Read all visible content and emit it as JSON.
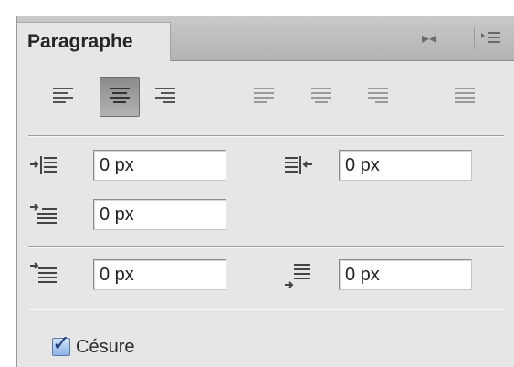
{
  "panel": {
    "tab_label": "Paragraphe",
    "tab_controls": {
      "collapse": "expand-arrows-icon",
      "menu": "panel-menu-icon"
    }
  },
  "alignment_buttons": [
    {
      "name": "align-left",
      "active": false
    },
    {
      "name": "align-center",
      "active": true
    },
    {
      "name": "align-right",
      "active": false
    },
    {
      "name": "justify-last-left",
      "active": false
    },
    {
      "name": "justify-last-center",
      "active": false
    },
    {
      "name": "justify-last-right",
      "active": false
    },
    {
      "name": "justify-all",
      "active": false
    }
  ],
  "indents": {
    "left_indent": "0 px",
    "right_indent": "0 px",
    "first_line_indent": "0 px"
  },
  "spacing": {
    "space_before": "0 px",
    "space_after": "0 px"
  },
  "hyphenation": {
    "label": "Césure",
    "checked": true
  },
  "colors": {
    "panel_bg": "#e6e6e6",
    "tabbar_bg": "#bdbdbd",
    "checkbox_blue": "#8fb4e6"
  }
}
